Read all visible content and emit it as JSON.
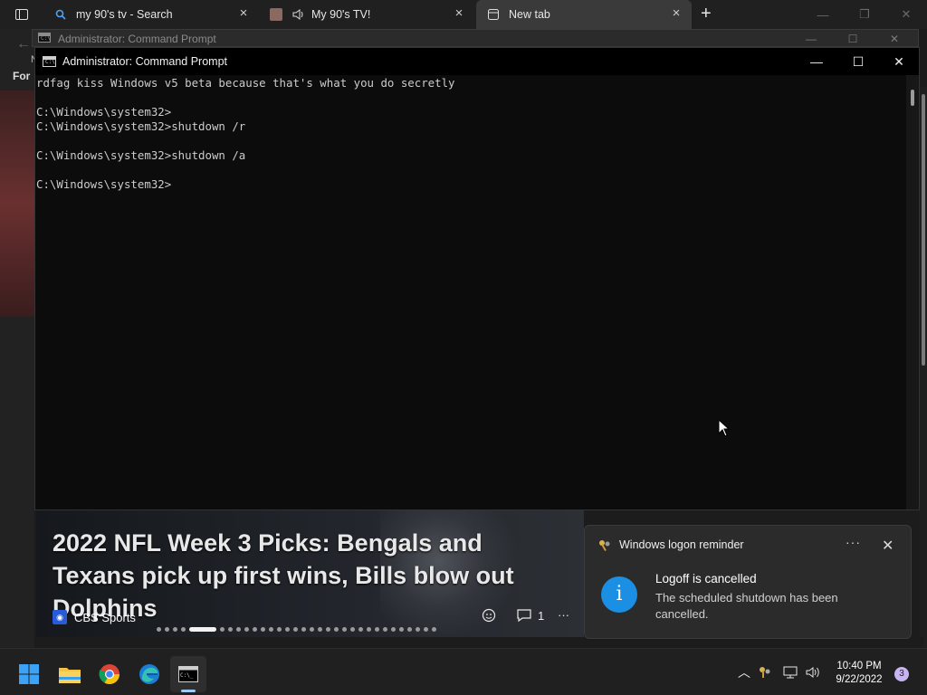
{
  "browser": {
    "tabs": [
      {
        "label": "my 90's tv - Search",
        "icon": "search-icon"
      },
      {
        "label": "My 90's TV!",
        "icon": "speaker-icon"
      },
      {
        "label": "New tab",
        "icon": "newtab-icon"
      }
    ],
    "new_tab_symbol": "+",
    "left_fragment_1": "N",
    "left_fragment_2": "For"
  },
  "cmd_back": {
    "title": "Administrator: Command Prompt"
  },
  "cmd": {
    "title": "Administrator: Command Prompt",
    "console_text": "rdfag kiss Windows v5 beta because that's what you do secretly\n\nC:\\Windows\\system32>\nC:\\Windows\\system32>shutdown /r\n\nC:\\Windows\\system32>shutdown /a\n\nC:\\Windows\\system32>"
  },
  "news": {
    "headline": "2022 NFL Week 3 Picks: Bengals and Texans pick up first wins, Bills blow out Dolphins",
    "source": "CBS Sports",
    "comments": "1",
    "more": "···"
  },
  "toast": {
    "app": "Windows logon reminder",
    "title": "Logoff is cancelled",
    "body": "The scheduled shutdown has been cancelled.",
    "more": "···",
    "info_symbol": "i"
  },
  "taskbar": {
    "apps": [
      "start-icon",
      "file-explorer-icon",
      "chrome-icon",
      "edge-icon",
      "terminal-icon"
    ],
    "clock_time": "10:40 PM",
    "clock_date": "9/22/2022",
    "notification_count": "3"
  },
  "colors": {
    "console_bg": "#0c0c0c",
    "console_text": "#cccccc",
    "toast_accent": "#1a8fe3"
  }
}
